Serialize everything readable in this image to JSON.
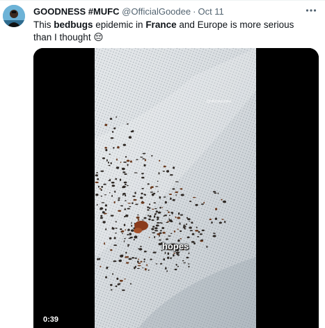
{
  "tweet": {
    "display_name": "GOODNESS #MUFC",
    "handle": "@OfficialGoodee",
    "separator": "·",
    "time": "Oct 11",
    "text": {
      "part1": "This ",
      "bold1": "bedbugs",
      "part2": " epidemic in ",
      "bold2": "France",
      "part3": " and Europe is more serious than I thought ",
      "emoji": "😔"
    },
    "more_icon": "more-horizontal-icon"
  },
  "video": {
    "duration": "0:39",
    "caption": "hopes",
    "watermark": "@officialgoodee"
  },
  "colors": {
    "text_primary": "#0f1419",
    "text_secondary": "#536471",
    "media_background": "#000000"
  }
}
